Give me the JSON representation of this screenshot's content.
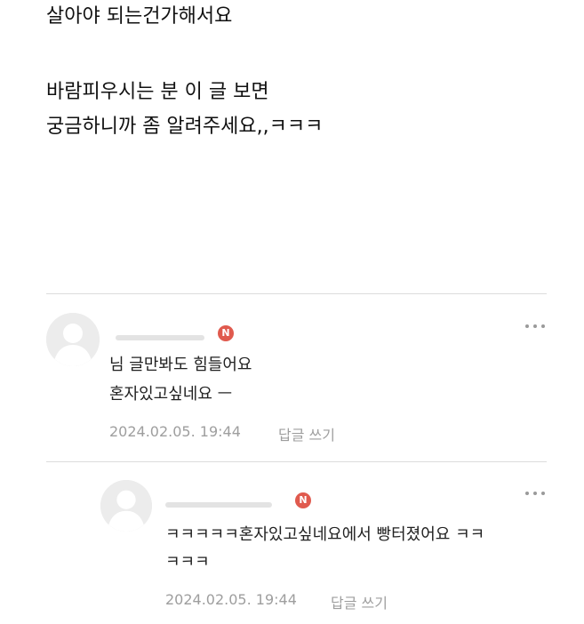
{
  "post": {
    "lines": [
      "살아야 되는건가해서요",
      "바람피우시는 분 이 글 보면",
      "궁금하니까 좀 알려주세요,,ㅋㅋㅋ"
    ]
  },
  "comments": [
    {
      "badge": "N",
      "lines": [
        "님 글만봐도 힘들어요",
        "혼자있고싶네요 ㅡ"
      ],
      "date": "2024.02.05. 19:44",
      "reply_label": "답글 쓰기",
      "more_icon": "more-dots-icon"
    },
    {
      "badge": "N",
      "lines": [
        "ㅋㅋㅋㅋㅋ혼자있고싶네요에서 빵터졌어요 ㅋㅋ",
        "ㅋㅋㅋ"
      ],
      "date": "2024.02.05. 19:44",
      "reply_label": "답글 쓰기",
      "more_icon": "more-dots-icon"
    }
  ],
  "colors": {
    "badge": "#e05a4e",
    "meta_text": "#9e9e9e",
    "divider": "#dcdcdc"
  }
}
